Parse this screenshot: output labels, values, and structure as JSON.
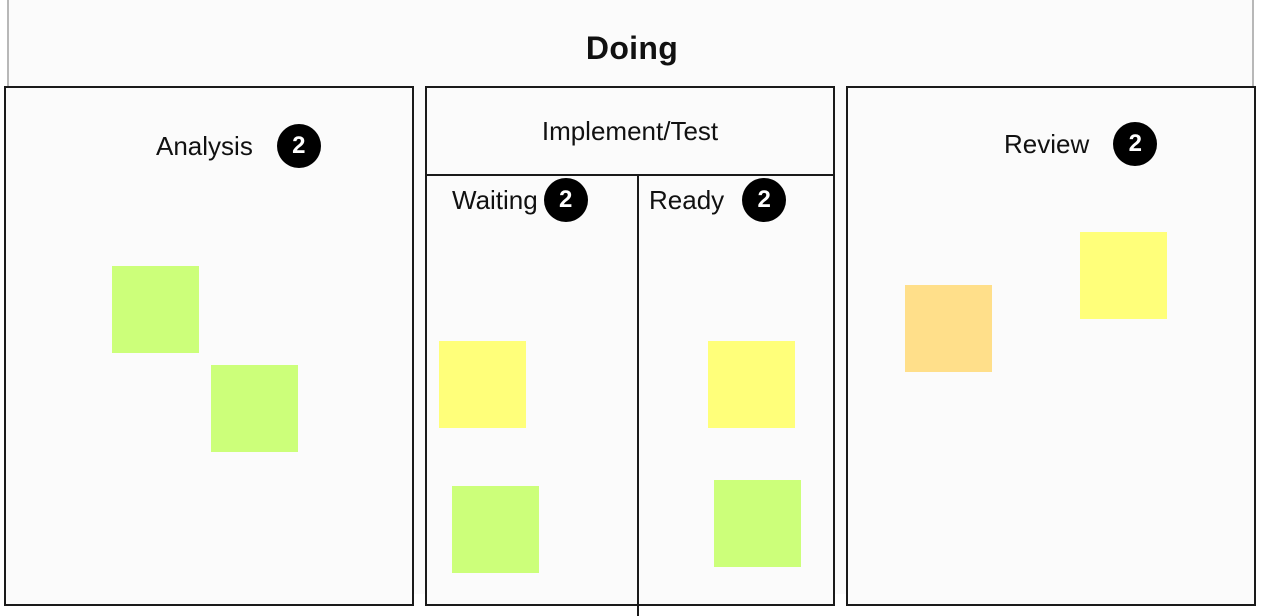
{
  "board": {
    "title": "Doing"
  },
  "columns": {
    "analysis": {
      "label": "Analysis",
      "count": "2"
    },
    "implement_test": {
      "label": "Implement/Test",
      "waiting": {
        "label": "Waiting",
        "count": "2"
      },
      "ready": {
        "label": "Ready",
        "count": "2"
      }
    },
    "review": {
      "label": "Review",
      "count": "2"
    }
  },
  "colors": {
    "sticky_green": "#ccff7a",
    "sticky_yellow": "#ffff7a",
    "sticky_orange": "#ffdf8a",
    "badge": "#000000"
  }
}
